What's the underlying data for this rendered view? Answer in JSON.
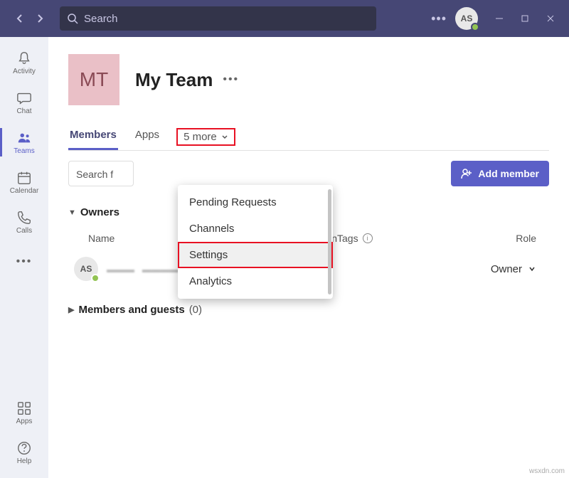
{
  "titlebar": {
    "search_placeholder": "Search",
    "avatar_initials": "AS"
  },
  "sidebar": {
    "items": [
      {
        "label": "Activity"
      },
      {
        "label": "Chat"
      },
      {
        "label": "Teams"
      },
      {
        "label": "Calendar"
      },
      {
        "label": "Calls"
      },
      {
        "label": "Apps"
      },
      {
        "label": "Help"
      }
    ]
  },
  "team": {
    "icon_initials": "MT",
    "name": "My Team"
  },
  "tabs": {
    "members": "Members",
    "apps": "Apps",
    "more": "5 more"
  },
  "dropdown": {
    "items": [
      "Pending Requests",
      "Channels",
      "Settings",
      "Analytics"
    ]
  },
  "toolbar": {
    "search_placeholder": "Search f",
    "add_member": "Add member"
  },
  "sections": {
    "owners_label": "Owners",
    "members_guests_label": "Members and guests",
    "members_guests_count": "(0)"
  },
  "table": {
    "headers": {
      "name": "Name",
      "location_suffix": "on",
      "tags": "Tags",
      "role": "Role"
    },
    "rows": [
      {
        "initials": "AS",
        "role": "Owner"
      }
    ]
  },
  "footer": {
    "watermark": "wsxdn.com"
  }
}
